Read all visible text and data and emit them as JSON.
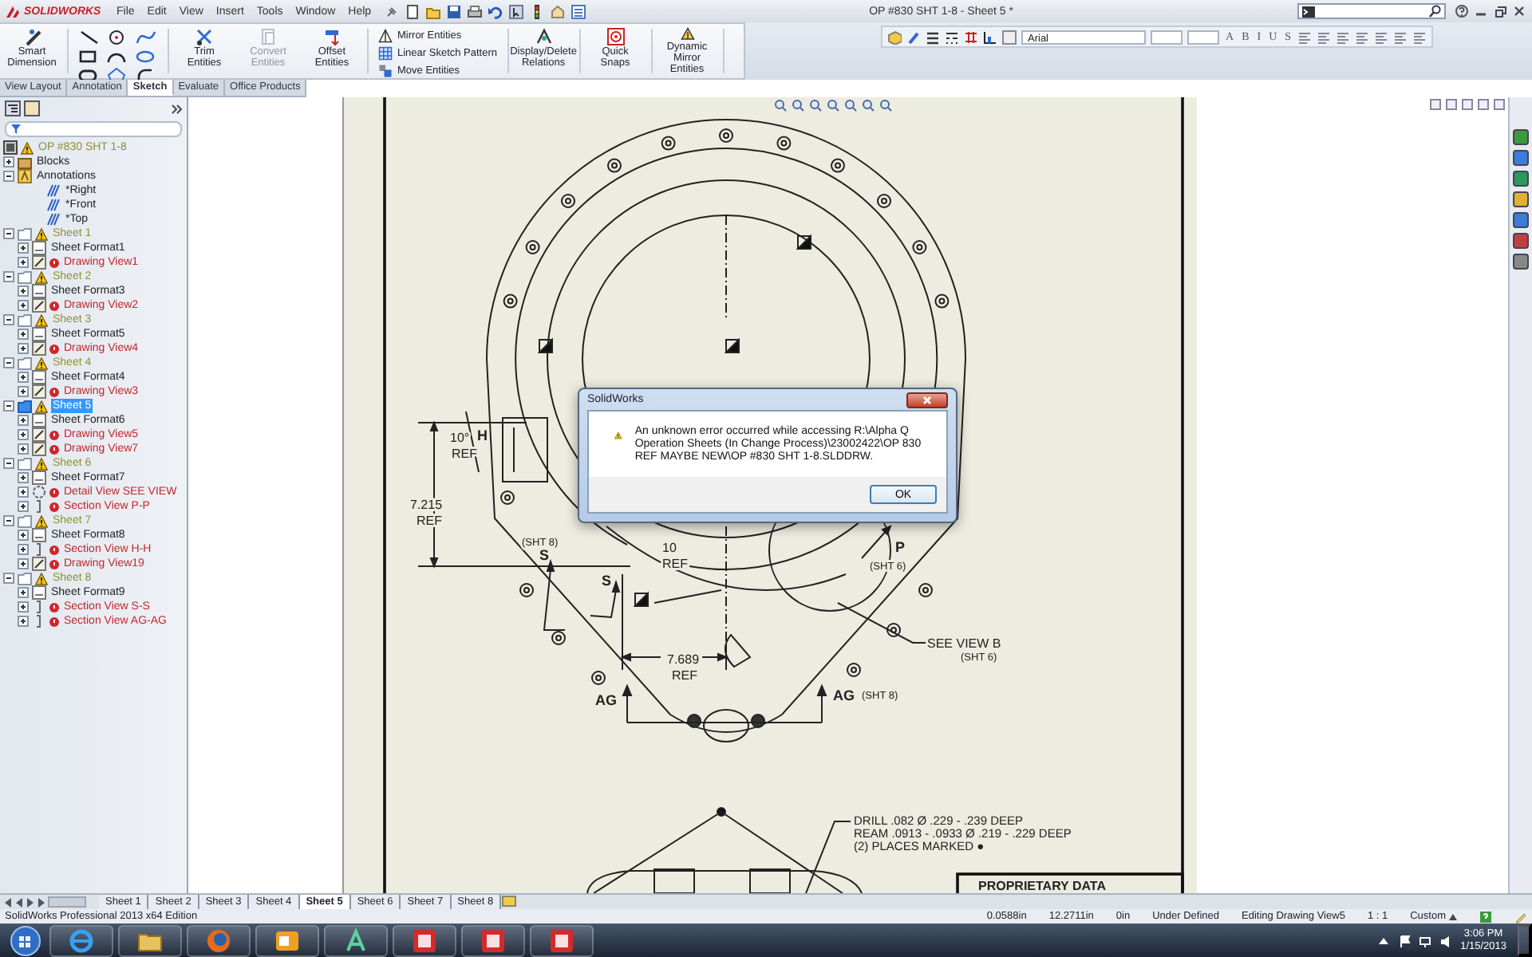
{
  "app": {
    "logo": "SOLIDWORKS",
    "menu": [
      "File",
      "Edit",
      "View",
      "Insert",
      "Tools",
      "Window",
      "Help"
    ],
    "title": "OP #830 SHT  1-8 - Sheet 5 *"
  },
  "ribbon": {
    "commands": [
      {
        "label": "Smart Dimension",
        "kind": "large",
        "disabled": false
      },
      {
        "label": "Trim Entities",
        "kind": "large",
        "disabled": false
      },
      {
        "label": "Convert Entities",
        "kind": "large",
        "disabled": true
      },
      {
        "label": "Offset Entities",
        "kind": "large",
        "disabled": false
      },
      {
        "label": "Mirror Entities",
        "kind": "small",
        "disabled": false
      },
      {
        "label": "Linear Sketch Pattern",
        "kind": "small",
        "disabled": false
      },
      {
        "label": "Move Entities",
        "kind": "small",
        "disabled": false
      },
      {
        "label": "Display/Delete Relations",
        "kind": "large",
        "disabled": false
      },
      {
        "label": "Quick Snaps",
        "kind": "large",
        "disabled": false
      },
      {
        "label": "Dynamic Mirror Entities",
        "kind": "large",
        "disabled": false
      }
    ],
    "font": "Arial",
    "format_buttons": [
      "A",
      "B",
      "I",
      "U",
      "S"
    ]
  },
  "tabs": [
    {
      "label": "View Layout",
      "selected": false
    },
    {
      "label": "Annotation",
      "selected": false
    },
    {
      "label": "Sketch",
      "selected": true
    },
    {
      "label": "Evaluate",
      "selected": false
    },
    {
      "label": "Office Products",
      "selected": false
    }
  ],
  "tree": {
    "items": [
      {
        "label": "OP #830 SHT  1-8",
        "kind": "root",
        "warning": true,
        "error": false,
        "selected": false,
        "children": [
          {
            "label": "Blocks",
            "kind": "blocks",
            "warning": false,
            "error": false,
            "expanded": false,
            "selected": false
          },
          {
            "label": "Annotations",
            "kind": "annotations",
            "warning": false,
            "error": false,
            "expanded": true,
            "selected": false,
            "children": [
              {
                "label": "*Right",
                "kind": "plane",
                "warning": false,
                "error": false,
                "selected": false
              },
              {
                "label": "*Front",
                "kind": "plane",
                "warning": false,
                "error": false,
                "selected": false
              },
              {
                "label": "*Top",
                "kind": "plane",
                "warning": false,
                "error": false,
                "selected": false
              }
            ]
          },
          {
            "label": "Sheet 1",
            "kind": "sheet",
            "warning": true,
            "error": false,
            "expanded": true,
            "selected": false,
            "children": [
              {
                "label": "Sheet Format1",
                "kind": "format",
                "warning": false,
                "error": false,
                "expanded": false,
                "selected": false
              },
              {
                "label": "Drawing View1",
                "kind": "view",
                "warning": false,
                "error": true,
                "expanded": false,
                "selected": false
              }
            ]
          },
          {
            "label": "Sheet 2",
            "kind": "sheet",
            "warning": true,
            "error": false,
            "expanded": true,
            "selected": false,
            "children": [
              {
                "label": "Sheet Format3",
                "kind": "format",
                "warning": false,
                "error": false,
                "expanded": false,
                "selected": false
              },
              {
                "label": "Drawing View2",
                "kind": "view",
                "warning": false,
                "error": true,
                "expanded": false,
                "selected": false
              }
            ]
          },
          {
            "label": "Sheet 3",
            "kind": "sheet",
            "warning": true,
            "error": false,
            "expanded": true,
            "selected": false,
            "children": [
              {
                "label": "Sheet Format5",
                "kind": "format",
                "warning": false,
                "error": false,
                "expanded": false,
                "selected": false
              },
              {
                "label": "Drawing View4",
                "kind": "view",
                "warning": false,
                "error": true,
                "expanded": false,
                "selected": false
              }
            ]
          },
          {
            "label": "Sheet 4",
            "kind": "sheet",
            "warning": true,
            "error": false,
            "expanded": true,
            "selected": false,
            "children": [
              {
                "label": "Sheet Format4",
                "kind": "format",
                "warning": false,
                "error": false,
                "expanded": false,
                "selected": false
              },
              {
                "label": "Drawing View3",
                "kind": "view",
                "warning": false,
                "error": true,
                "expanded": false,
                "selected": false
              }
            ]
          },
          {
            "label": "Sheet 5",
            "kind": "sheet",
            "warning": true,
            "error": false,
            "expanded": true,
            "selected": true,
            "children": [
              {
                "label": "Sheet Format6",
                "kind": "format",
                "warning": false,
                "error": false,
                "expanded": false,
                "selected": false
              },
              {
                "label": "Drawing View5",
                "kind": "view",
                "warning": false,
                "error": true,
                "expanded": false,
                "selected": false
              },
              {
                "label": "Drawing View7",
                "kind": "view",
                "warning": false,
                "error": true,
                "expanded": false,
                "selected": false
              }
            ]
          },
          {
            "label": "Sheet 6",
            "kind": "sheet",
            "warning": true,
            "error": false,
            "expanded": true,
            "selected": false,
            "children": [
              {
                "label": "Sheet Format7",
                "kind": "format",
                "warning": false,
                "error": false,
                "expanded": false,
                "selected": false
              },
              {
                "label": "Detail View SEE VIEW",
                "kind": "detail",
                "warning": false,
                "error": true,
                "expanded": false,
                "selected": false
              },
              {
                "label": "Section View P-P",
                "kind": "section",
                "warning": false,
                "error": true,
                "expanded": false,
                "selected": false
              }
            ]
          },
          {
            "label": "Sheet 7",
            "kind": "sheet",
            "warning": true,
            "error": false,
            "expanded": true,
            "selected": false,
            "children": [
              {
                "label": "Sheet Format8",
                "kind": "format",
                "warning": false,
                "error": false,
                "expanded": false,
                "selected": false
              },
              {
                "label": "Section View H-H",
                "kind": "section",
                "warning": false,
                "error": true,
                "expanded": false,
                "selected": false
              },
              {
                "label": "Drawing View19",
                "kind": "view",
                "warning": false,
                "error": true,
                "expanded": false,
                "selected": false
              }
            ]
          },
          {
            "label": "Sheet 8",
            "kind": "sheet",
            "warning": true,
            "error": false,
            "expanded": true,
            "selected": false,
            "children": [
              {
                "label": "Sheet Format9",
                "kind": "format",
                "warning": false,
                "error": false,
                "expanded": false,
                "selected": false
              },
              {
                "label": "Section View S-S",
                "kind": "section",
                "warning": false,
                "error": true,
                "expanded": false,
                "selected": false
              },
              {
                "label": "Section View AG-AG",
                "kind": "section",
                "warning": false,
                "error": true,
                "expanded": false,
                "selected": false
              }
            ]
          }
        ]
      }
    ]
  },
  "drawing": {
    "labels": [
      {
        "text": "10°",
        "kind": "dimension"
      },
      {
        "text": "REF",
        "kind": "dimension"
      },
      {
        "text": "H",
        "kind": "section"
      },
      {
        "text": "7.215",
        "kind": "dimension"
      },
      {
        "text": "REF",
        "kind": "dimension"
      },
      {
        "text": "(SHT 8)",
        "kind": "reference"
      },
      {
        "text": "S",
        "kind": "section"
      },
      {
        "text": "S",
        "kind": "section"
      },
      {
        "text": "10",
        "kind": "dimension"
      },
      {
        "text": "REF",
        "kind": "dimension"
      },
      {
        "text": "P",
        "kind": "section"
      },
      {
        "text": "(SHT 6)",
        "kind": "reference"
      },
      {
        "text": "SEE VIEW B",
        "kind": "callout"
      },
      {
        "text": "(SHT 6)",
        "kind": "reference"
      },
      {
        "text": "7.689",
        "kind": "dimension"
      },
      {
        "text": "REF",
        "kind": "dimension"
      },
      {
        "text": "AG",
        "kind": "section"
      },
      {
        "text": "AG",
        "kind": "section"
      },
      {
        "text": "(SHT 8)",
        "kind": "reference"
      },
      {
        "text": "DRILL .082 Ø .229 - .239 DEEP",
        "kind": "note"
      },
      {
        "text": "REAM .0913 - .0933 Ø .219 - .229 DEEP",
        "kind": "note"
      },
      {
        "text": "(2) PLACES MARKED ●",
        "kind": "note"
      },
      {
        "text": "PROPRIETARY DATA",
        "kind": "title"
      }
    ]
  },
  "dialog": {
    "title": "SolidWorks",
    "message": "An unknown error occurred while accessing R:\\Alpha Q Operation Sheets (In Change Process)\\23002422\\OP 830 REF MAYBE NEW\\OP #830 SHT  1-8.SLDDRW.",
    "button": "OK"
  },
  "sheet_tabs": [
    {
      "label": "Sheet 1",
      "selected": false
    },
    {
      "label": "Sheet 2",
      "selected": false
    },
    {
      "label": "Sheet 3",
      "selected": false
    },
    {
      "label": "Sheet 4",
      "selected": false
    },
    {
      "label": "Sheet 5",
      "selected": true
    },
    {
      "label": "Sheet 6",
      "selected": false
    },
    {
      "label": "Sheet 7",
      "selected": false
    },
    {
      "label": "Sheet 8",
      "selected": false
    }
  ],
  "status_bar": {
    "product": "SolidWorks Professional 2013 x64 Edition",
    "x": "0.0588in",
    "y": "12.2711in",
    "z": "0in",
    "sketch_state": "Under Defined",
    "mode": "Editing Drawing View5",
    "scale": "1 : 1",
    "units": "Custom"
  },
  "taskbar": {
    "time": "3:06 PM",
    "date": "1/15/2013"
  }
}
